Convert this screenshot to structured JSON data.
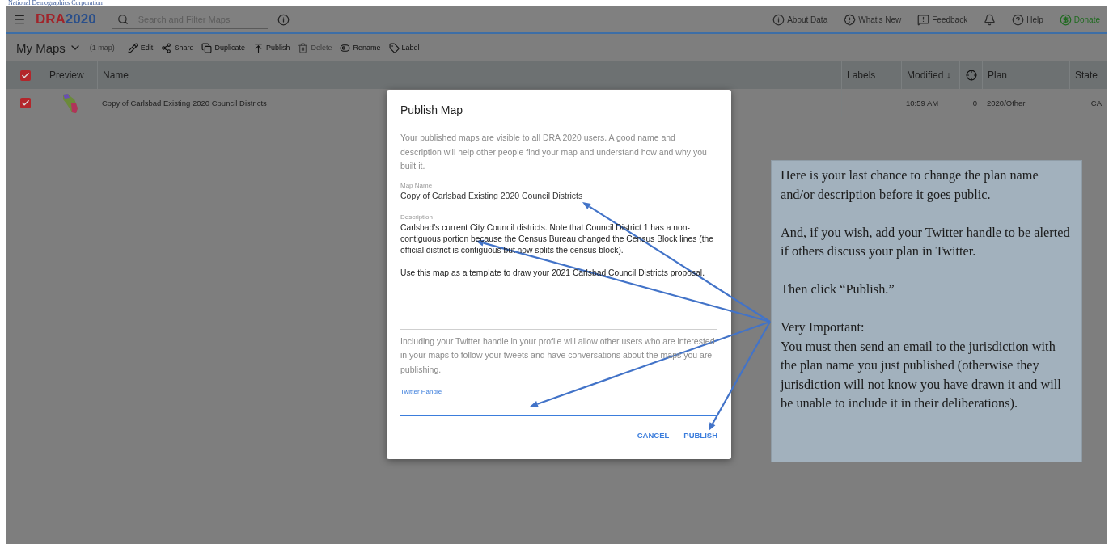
{
  "caption": "National Demographics Corporation",
  "top_bar": {
    "logo": {
      "part_1": "DRA",
      "part_2": "2020"
    },
    "search": {
      "placeholder": "Search and Filter Maps"
    },
    "links": [
      {
        "label": "About Data",
        "kind": "info"
      },
      {
        "label": "What's New",
        "kind": "news"
      },
      {
        "label": "Feedback",
        "kind": "feedback"
      },
      {
        "kind": "bell"
      },
      {
        "label": "Help",
        "kind": "help"
      },
      {
        "label": "Donate",
        "kind": "donate"
      }
    ]
  },
  "toolbar": {
    "title": "My Maps",
    "count": "(1 map)",
    "actions": [
      {
        "label": "Edit",
        "kind": "edit",
        "disabled": false
      },
      {
        "label": "Share",
        "kind": "share",
        "disabled": false
      },
      {
        "label": "Duplicate",
        "kind": "duplicate",
        "disabled": false
      },
      {
        "label": "Publish",
        "kind": "publish",
        "disabled": false
      },
      {
        "label": "Delete",
        "kind": "delete",
        "disabled": true
      },
      {
        "label": "Rename",
        "kind": "rename",
        "disabled": false
      },
      {
        "label": "Label",
        "kind": "label",
        "disabled": false
      }
    ]
  },
  "table": {
    "all_checked": true,
    "columns": [
      {
        "label": "Preview",
        "kind": "preview"
      },
      {
        "label": "Name",
        "kind": "name"
      },
      {
        "label": "Labels",
        "kind": "labels"
      },
      {
        "label": "Modified ↓",
        "kind": "modified"
      },
      {
        "kind": "icon"
      },
      {
        "label": "Plan",
        "kind": "plan"
      },
      {
        "label": "State",
        "kind": "state"
      }
    ],
    "rows": [
      {
        "checked": true,
        "name": "Copy of Carlsbad Existing 2020 Council Districts",
        "modified": "10:59 AM",
        "count": "0",
        "plan": "2020/Other",
        "state": "CA"
      }
    ]
  },
  "dialog": {
    "title": "Publish Map",
    "intro": "Your published maps are visible to all DRA 2020 users. A good name and description will help other people find your map and understand how and why you built it.",
    "name_label": "Map Name",
    "name_value": "Copy of Carlsbad Existing 2020 Council Districts",
    "description_label": "Description",
    "description_value": "Carlsbad's current City Council districts. Note that Council District 1 has a non-contiguous portion because the Census Bureau changed the Census Block lines (the official district is contiguous but now splits the census block).\n\nUse this map as a template to draw your 2021 Carlsbad Council Districts proposal.",
    "twitter_intro": "Including your Twitter handle in your profile will allow other users who are interested in your maps to follow your tweets and have conversations about the maps you are publishing.",
    "twitter_label": "Twitter Handle",
    "buttons": [
      "CANCEL",
      "PUBLISH"
    ]
  },
  "callout": {
    "paragraphs": [
      "Here is your last chance to change the plan name and/or description before it goes public.",
      "And, if  you wish, add your Twitter handle to be alerted if  others discuss your plan in Twitter.",
      "Then click  “Publish.”",
      "Very Important:\nYou must then send an email to the jurisdiction with the plan name you just published (otherwise they jurisdiction will  not know you have drawn it and will  be unable  to include it in their deliberations)."
    ]
  }
}
